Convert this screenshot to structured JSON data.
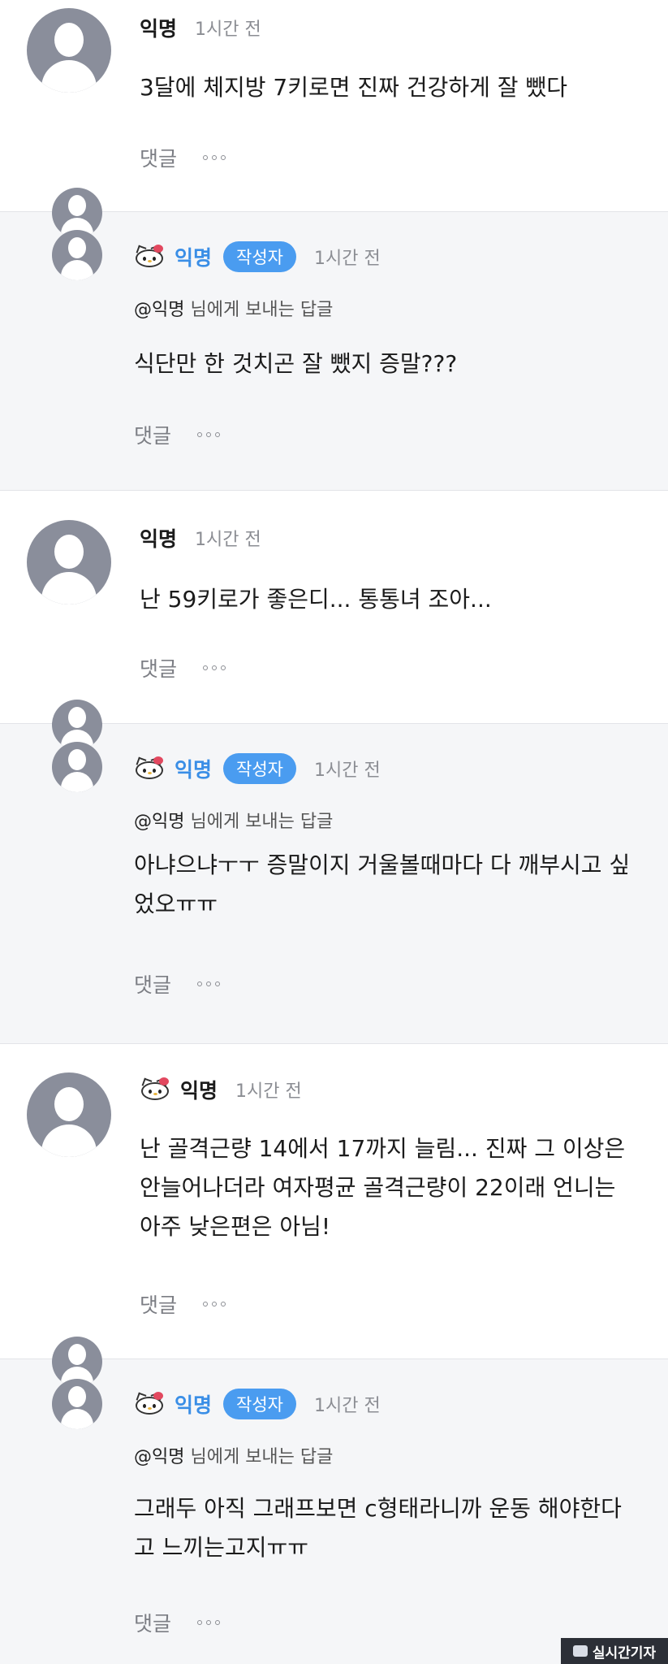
{
  "comments": [
    {
      "name": "익명",
      "time": "1시간 전",
      "text": "3달에 체지방 7키로면 진짜 건강하게 잘 뺐다",
      "reply_label": "댓글"
    },
    {
      "name": "익명",
      "badge": "작성자",
      "time": "1시간 전",
      "reply_to_mention": "@익명",
      "reply_to_suffix": " 님에게 보내는 답글",
      "text": "식단만 한 것치곤 잘 뺐지 증말???",
      "reply_label": "댓글"
    },
    {
      "name": "익명",
      "time": "1시간 전",
      "text": "난 59키로가 좋은디... 통통녀 조아...",
      "reply_label": "댓글"
    },
    {
      "name": "익명",
      "badge": "작성자",
      "time": "1시간 전",
      "reply_to_mention": "@익명",
      "reply_to_suffix": " 님에게 보내는 답글",
      "text": "아냐으냐ㅜㅜ 증말이지 거울볼때마다 다 깨부시고 싶었오ㅠㅠ",
      "reply_label": "댓글"
    },
    {
      "name": "익명",
      "time": "1시간 전",
      "text": "난 골격근량 14에서 17까지 늘림... 진짜 그 이상은 안늘어나더라 여자평균 골격근량이 22이래 언니는 아주 낮은편은 아님!",
      "reply_label": "댓글"
    },
    {
      "name": "익명",
      "badge": "작성자",
      "time": "1시간 전",
      "reply_to_mention": "@익명",
      "reply_to_suffix": " 님에게 보내는 답글",
      "text": "그래두 아직 그래프보면 c형태라니까 운동 해야한다고 느끼는고지ㅠㅠ",
      "reply_label": "댓글"
    }
  ],
  "watermark": "실시간기자",
  "colors": {
    "author_name": "#3a8ee6",
    "author_badge": "#4a9cf0",
    "reply_bg": "#f5f6f8",
    "avatar": "#8a8e9b"
  }
}
